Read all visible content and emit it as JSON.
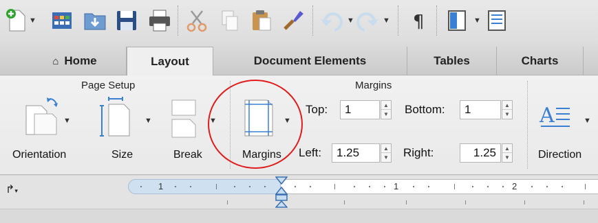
{
  "quick_access": {
    "buttons": [
      "new-document",
      "templates",
      "open",
      "save",
      "print",
      "cut",
      "copy",
      "paste",
      "format-painter",
      "undo",
      "redo",
      "show-formatting",
      "view",
      "outline"
    ]
  },
  "tabs": [
    {
      "label": "Home",
      "active": false
    },
    {
      "label": "Layout",
      "active": true
    },
    {
      "label": "Document Elements",
      "active": false
    },
    {
      "label": "Tables",
      "active": false
    },
    {
      "label": "Charts",
      "active": false
    }
  ],
  "ribbon": {
    "page_setup": {
      "group_label": "Page Setup",
      "orientation_label": "Orientation",
      "size_label": "Size",
      "break_label": "Break"
    },
    "margins": {
      "group_label": "Margins",
      "button_label": "Margins",
      "top_label": "Top:",
      "top_value": "1",
      "bottom_label": "Bottom:",
      "bottom_value": "1",
      "left_label": "Left:",
      "left_value": "1.25",
      "right_label": "Right:",
      "right_value": "1.25"
    },
    "text": {
      "direction_label": "Direction"
    }
  },
  "ruler": {
    "numbers": [
      "1",
      "1",
      "2"
    ]
  },
  "colors": {
    "highlight": "#e01b1b",
    "ruler_margin": "#cfe0f0",
    "icon_blue": "#3a7fd1"
  }
}
